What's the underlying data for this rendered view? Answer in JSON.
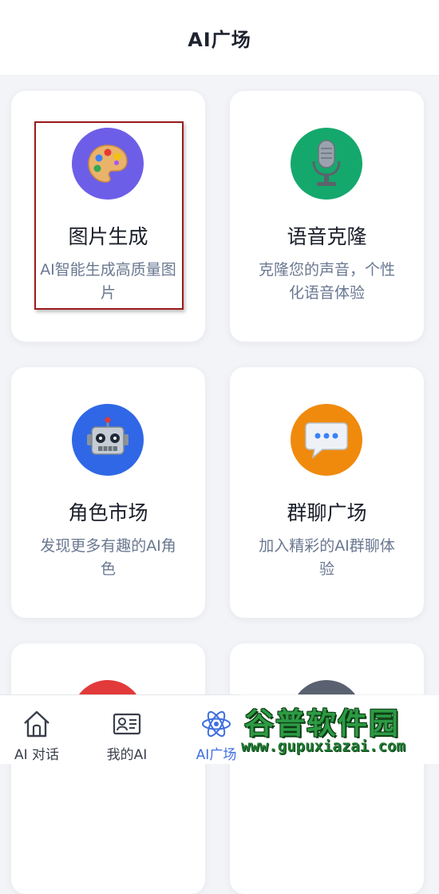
{
  "header": {
    "title": "AI广场"
  },
  "cards": [
    {
      "title": "图片生成",
      "desc": "AI智能生成高质量图片",
      "icon": "palette-icon",
      "color": "#6d5ee8"
    },
    {
      "title": "语音克隆",
      "desc": "克隆您的声音，个性化语音体验",
      "icon": "microphone-icon",
      "color": "#15a86c"
    },
    {
      "title": "角色市场",
      "desc": "发现更多有趣的AI角色",
      "icon": "robot-icon",
      "color": "#2f67e6"
    },
    {
      "title": "群聊广场",
      "desc": "加入精彩的AI群聊体验",
      "icon": "chat-bubble-icon",
      "color": "#f08a0c"
    },
    {
      "icon": "red-circle-icon",
      "color": "#e23a3a"
    },
    {
      "icon": "gray-circle-icon",
      "color": "#5a6170"
    }
  ],
  "nav": [
    {
      "label": "AI 对话",
      "icon": "home-icon",
      "active": false
    },
    {
      "label": "我的AI",
      "icon": "id-card-icon",
      "active": false
    },
    {
      "label": "AI广场",
      "icon": "atom-icon",
      "active": true
    }
  ],
  "watermark": {
    "title": "谷普软件园",
    "url": "www.gupuxiazai.com"
  },
  "colors": {
    "active": "#3f6fe0",
    "text_muted": "#6a7891",
    "frame": "#9a1b1b"
  }
}
